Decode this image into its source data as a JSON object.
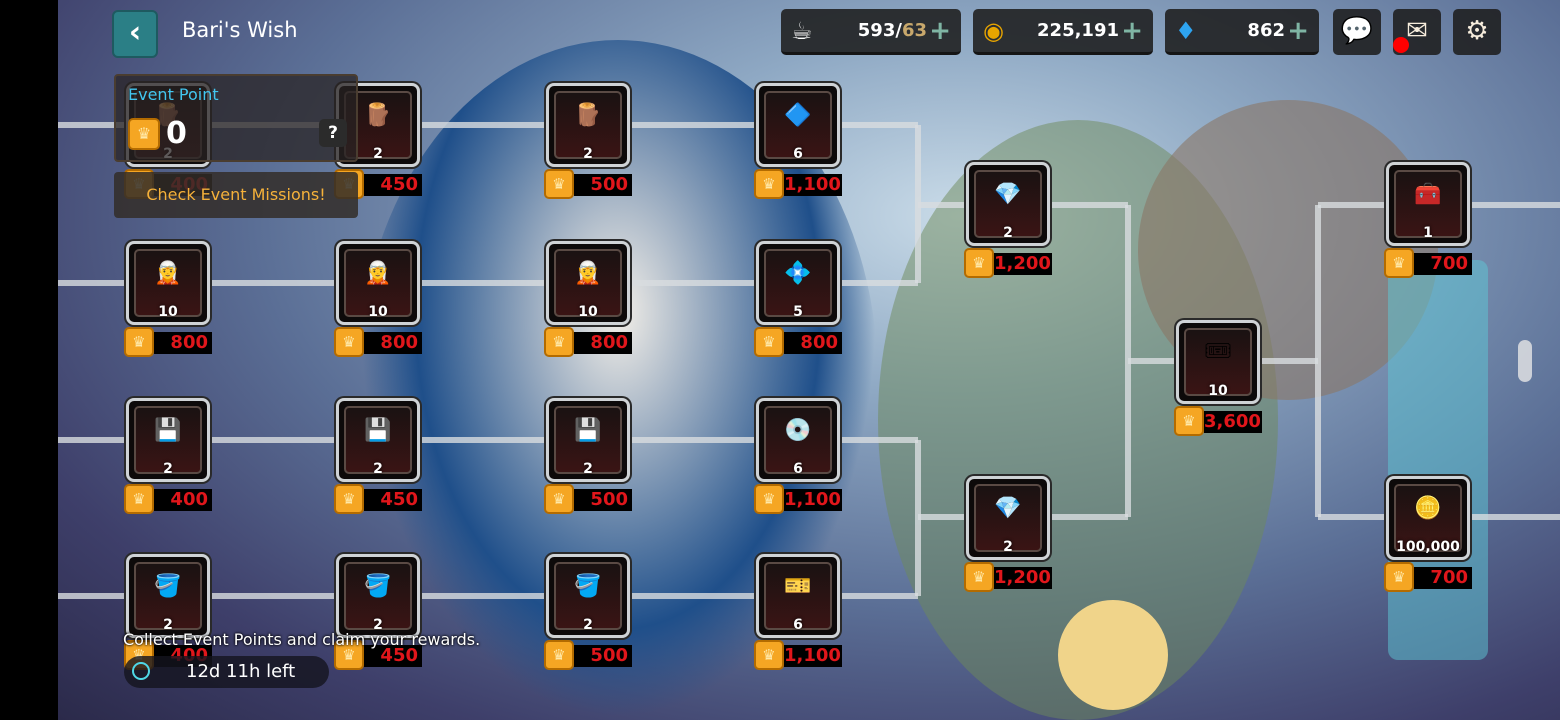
{
  "header": {
    "title": "Bari's Wish",
    "back_icon": "chevron-left-icon"
  },
  "resources": [
    {
      "name": "stamina",
      "icon": "coffee-cup-icon",
      "value": "593",
      "max": "63"
    },
    {
      "name": "gold",
      "icon": "gold-coin-icon",
      "value": "225,191"
    },
    {
      "name": "gems",
      "icon": "blue-gem-icon",
      "value": "862"
    }
  ],
  "buttons": {
    "chat": "chat-icon",
    "mail": "mail-icon",
    "settings": "gear-icon",
    "mail_badge_color": "#ff0000"
  },
  "event_point": {
    "label": "Event Point",
    "value": "0",
    "help": "?",
    "missions_button": "Check Event Missions!"
  },
  "footer": {
    "hint": "Collect Event Points and claim your rewards.",
    "time_left": "12d 11h left"
  },
  "rewards": [
    {
      "col": 0,
      "row": 0,
      "item": "wood-plank",
      "icon": "🪵",
      "count": "2",
      "cost": "400"
    },
    {
      "col": 0,
      "row": 1,
      "item": "character-card",
      "icon": "🧝",
      "count": "10",
      "cost": "800"
    },
    {
      "col": 0,
      "row": 2,
      "item": "green-chip",
      "icon": "💾",
      "count": "2",
      "cost": "400"
    },
    {
      "col": 0,
      "row": 3,
      "item": "paint-bucket",
      "icon": "🪣",
      "count": "2",
      "cost": "400"
    },
    {
      "col": 1,
      "row": 0,
      "item": "wood-plank",
      "icon": "🪵",
      "count": "2",
      "cost": "450"
    },
    {
      "col": 1,
      "row": 1,
      "item": "character-card",
      "icon": "🧝",
      "count": "10",
      "cost": "800"
    },
    {
      "col": 1,
      "row": 2,
      "item": "green-chip",
      "icon": "💾",
      "count": "2",
      "cost": "450"
    },
    {
      "col": 1,
      "row": 3,
      "item": "paint-bucket",
      "icon": "🪣",
      "count": "2",
      "cost": "450"
    },
    {
      "col": 2,
      "row": 0,
      "item": "wood-plank",
      "icon": "🪵",
      "count": "2",
      "cost": "500"
    },
    {
      "col": 2,
      "row": 1,
      "item": "character-card",
      "icon": "🧝",
      "count": "10",
      "cost": "800"
    },
    {
      "col": 2,
      "row": 2,
      "item": "green-chip",
      "icon": "💾",
      "count": "2",
      "cost": "500"
    },
    {
      "col": 2,
      "row": 3,
      "item": "paint-bucket",
      "icon": "🪣",
      "count": "2",
      "cost": "500"
    },
    {
      "col": 3,
      "row": 0,
      "item": "purple-crystal",
      "icon": "🔷",
      "count": "6",
      "cost": "1,100"
    },
    {
      "col": 3,
      "row": 1,
      "item": "prism-crystal",
      "icon": "💠",
      "count": "5",
      "cost": "800"
    },
    {
      "col": 3,
      "row": 2,
      "item": "disc",
      "icon": "💿",
      "count": "6",
      "cost": "1,100"
    },
    {
      "col": 3,
      "row": 3,
      "item": "ticket-chip",
      "icon": "🎫",
      "count": "6",
      "cost": "1,100"
    },
    {
      "col": 4,
      "row": 0.5,
      "item": "star-gem",
      "icon": "💎",
      "count": "2",
      "cost": "1,200"
    },
    {
      "col": 4,
      "row": 2.5,
      "item": "star-gem",
      "icon": "💎",
      "count": "2",
      "cost": "1,200"
    },
    {
      "col": 5,
      "row": 1.5,
      "item": "purple-ticket",
      "icon": "🎟",
      "count": "10",
      "cost": "3,600"
    },
    {
      "col": 6,
      "row": 0.5,
      "item": "treasure-chest",
      "icon": "🧰",
      "count": "1",
      "cost": "700"
    },
    {
      "col": 6,
      "row": 2.5,
      "item": "gold-coin",
      "icon": "🪙",
      "count": "100,000",
      "cost": "700"
    }
  ]
}
